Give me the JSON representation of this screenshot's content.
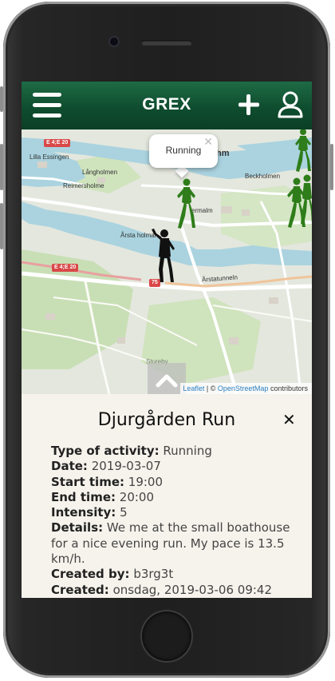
{
  "header": {
    "brand": "GREX",
    "icons": [
      "menu-icon",
      "plus-icon",
      "user-icon"
    ]
  },
  "map": {
    "popup": {
      "label": "Running"
    },
    "labels": {
      "lilla_essingen": "Lilla Essingen",
      "langholmen": "Långholmen",
      "reimersholme": "Reimersholme",
      "arsta_holmar": "Årsta holmar",
      "beckholmen": "Beckholmen",
      "ermalm": "ermalm",
      "arstatunneln": "Årstatunneln",
      "stureby": "Stureby",
      "hm": "hm"
    },
    "road_shields": [
      "E 4;E 20",
      "E 4;E 20",
      "75"
    ],
    "attribution": {
      "leaflet": "Leaflet",
      "separator": "| ©",
      "osm": "OpenStreetMap",
      "suffix": "contributors"
    }
  },
  "event": {
    "title": "Djurgården Run",
    "close": "✕",
    "fields": [
      {
        "label": "Type of activity:",
        "value": "Running"
      },
      {
        "label": "Date:",
        "value": "2019-03-07"
      },
      {
        "label": "Start time:",
        "value": "19:00"
      },
      {
        "label": "End time:",
        "value": "20:00"
      },
      {
        "label": "Intensity:",
        "value": "5"
      },
      {
        "label": "Details:",
        "value": "We me at the small boathouse for a nice evening run. My pace is 13.5 km/h."
      },
      {
        "label": "Created by:",
        "value": "b3rg3t"
      },
      {
        "label": "Created:",
        "value": "onsdag, 2019-03-06 09:42"
      }
    ]
  },
  "colors": {
    "header_green": "#0f4d2f",
    "runner_green": "#2e7d1a",
    "water": "#aad3df",
    "panel_bg": "#f6f3ec",
    "link_blue": "#2a7fc0"
  }
}
